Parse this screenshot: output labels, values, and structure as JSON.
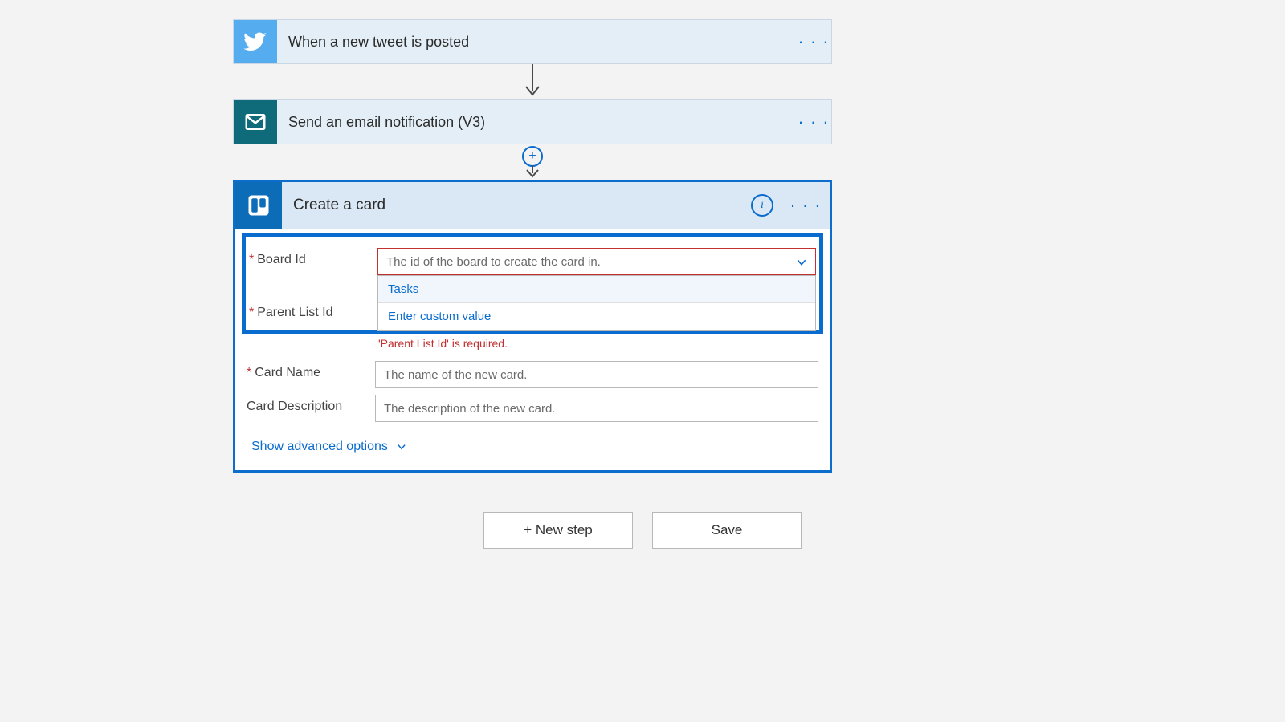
{
  "steps": {
    "twitter": {
      "title": "When a new tweet is posted"
    },
    "email": {
      "title": "Send an email notification (V3)"
    },
    "trello": {
      "title": "Create a card"
    }
  },
  "form": {
    "board_id": {
      "label": "Board Id",
      "placeholder": "The id of the board to create the card in.",
      "options": [
        "Tasks",
        "Enter custom value"
      ]
    },
    "parent_list_id": {
      "label": "Parent List Id",
      "error_text": "'Parent List Id' is required."
    },
    "card_name": {
      "label": "Card Name",
      "placeholder": "The name of the new card."
    },
    "card_description": {
      "label": "Card Description",
      "placeholder": "The description of the new card."
    },
    "show_advanced": "Show advanced options"
  },
  "buttons": {
    "new_step": "+ New step",
    "save": "Save"
  },
  "colors": {
    "twitter": "#55acee",
    "outlook": "#0f6a7a",
    "trello": "#0d6cb8",
    "accent": "#0a6ccf"
  }
}
